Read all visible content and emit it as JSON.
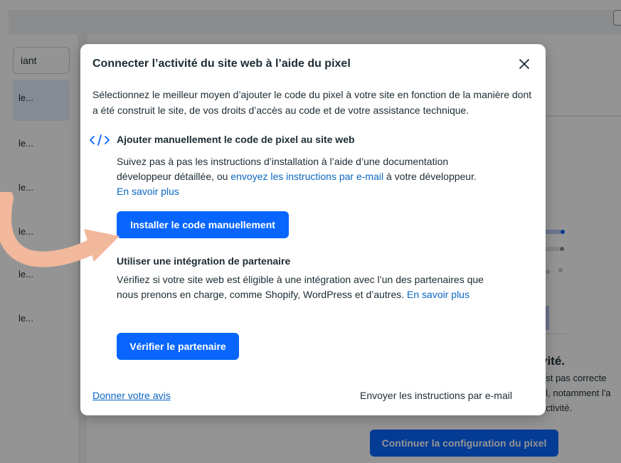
{
  "background": {
    "search_value": "iant",
    "sidebar_items": [
      "le...",
      "le...",
      "le...",
      "le...",
      "le...",
      "le..."
    ],
    "heading_partial": "vité.",
    "lines_partial": [
      "est pas correcte",
      "el, notamment l'a",
      "activité."
    ],
    "continue_button": "Continuer la configuration du pixel"
  },
  "modal": {
    "title": "Connecter l’activité du site web à l’aide du pixel",
    "description": "Sélectionnez le meilleur moyen d’ajouter le code du pixel à votre site en fonction de la manière dont a été construit le site, de vos droits d’accès au code et de votre assistance technique.",
    "manual": {
      "icon": "code-icon",
      "title": "Ajouter manuellement le code de pixel au site web",
      "desc_before": "Suivez pas à pas les instructions d’installation à l’aide d’une documentation développeur détaillée, ou ",
      "desc_link": "envoyez les instructions par e-mail",
      "desc_after": " à votre développeur.",
      "learn_more": "En savoir plus",
      "button": "Installer le code manuellement"
    },
    "partner": {
      "title": "Utiliser une intégration de partenaire",
      "desc": "Vérifiez si votre site web est éligible à une intégration avec l’un des partenaires que nous prenons en charge, comme Shopify, WordPress et d’autres. ",
      "learn_more": "En savoir plus",
      "button": "Vérifier le partenaire"
    },
    "footer": {
      "feedback": "Donner votre avis",
      "send_email": "Envoyer les instructions par e-mail"
    }
  },
  "colors": {
    "primary": "#0866ff",
    "link": "#0a66c2",
    "arrow": "#f2b89c",
    "text": "#1c2b33"
  }
}
